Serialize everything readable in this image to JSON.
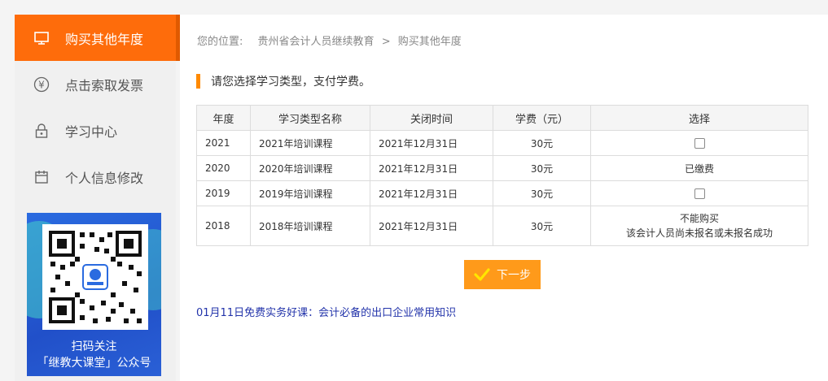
{
  "sidebar": {
    "items": [
      {
        "label": "购买其他年度",
        "icon": "monitor-icon",
        "active": true
      },
      {
        "label": "点击索取发票",
        "icon": "yen-icon",
        "active": false
      },
      {
        "label": "学习中心",
        "icon": "lock-icon",
        "active": false
      },
      {
        "label": "个人信息修改",
        "icon": "calendar-icon",
        "active": false
      }
    ],
    "qr": {
      "caption_line1": "扫码关注",
      "caption_line2": "「继教大课堂」公众号"
    }
  },
  "breadcrumb": {
    "prefix": "您的位置:",
    "items": [
      "贵州省会计人员继续教育",
      "购买其他年度"
    ],
    "separator": ">"
  },
  "section": {
    "title": "请您选择学习类型，支付学费。",
    "accent_color": "#ff8a00"
  },
  "table": {
    "headers": [
      "年度",
      "学习类型名称",
      "关闭时间",
      "学费（元）",
      "选择"
    ],
    "rows": [
      {
        "year": "2021",
        "name": "2021年培训课程",
        "close_time": "2021年12月31日",
        "fee": "30元",
        "select_type": "checkbox"
      },
      {
        "year": "2020",
        "name": "2020年培训课程",
        "close_time": "2021年12月31日",
        "fee": "30元",
        "select_type": "text",
        "select_text": "已缴费"
      },
      {
        "year": "2019",
        "name": "2019年培训课程",
        "close_time": "2021年12月31日",
        "fee": "30元",
        "select_type": "checkbox"
      },
      {
        "year": "2018",
        "name": "2018年培训课程",
        "close_time": "2021年12月31日",
        "fee": "30元",
        "select_type": "text",
        "select_text": "不能购买",
        "select_note": "该会计人员尚未报名或未报名成功"
      }
    ]
  },
  "next_button": {
    "label": "下一步",
    "icon": "check-icon",
    "color": "#ff9a1a"
  },
  "promo_link": "01月11日免费实务好课：会计必备的出口企业常用知识",
  "colors": {
    "active_nav": "#fe6c0b",
    "link": "#2233aa"
  }
}
